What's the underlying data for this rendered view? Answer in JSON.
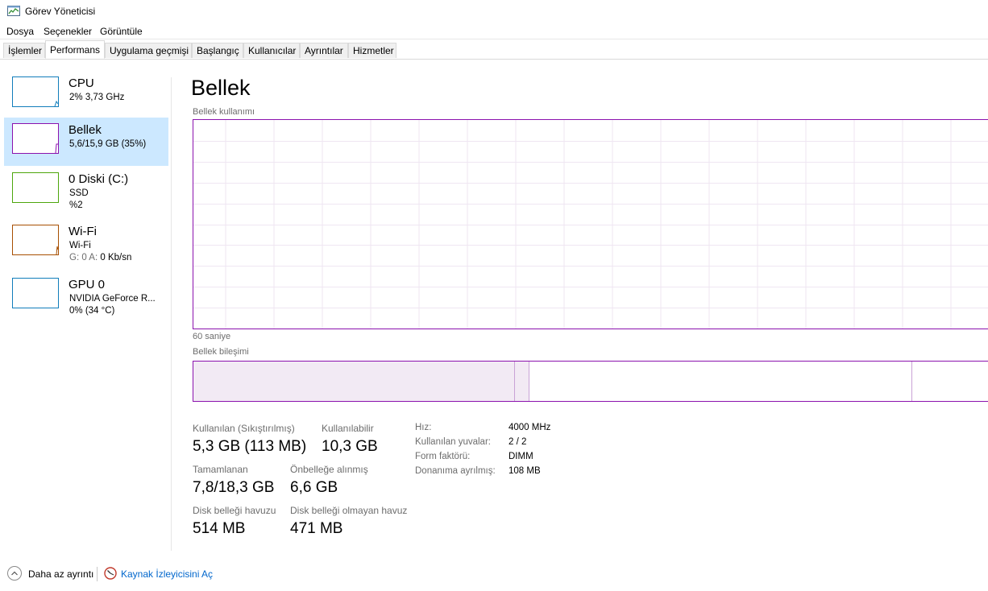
{
  "window": {
    "title": "Görev Yöneticisi"
  },
  "menu": [
    "Dosya",
    "Seçenekler",
    "Görüntüle"
  ],
  "tabs": [
    "İşlemler",
    "Performans",
    "Uygulama geçmişi",
    "Başlangıç",
    "Kullanıcılar",
    "Ayrıntılar",
    "Hizmetler"
  ],
  "active_tab": "Performans",
  "sidebar": {
    "items": [
      {
        "name": "CPU",
        "sub1": "2%  3,73 GHz",
        "sub2": "",
        "color": "#117dbb",
        "selected": false
      },
      {
        "name": "Bellek",
        "sub1": "5,6/15,9 GB (35%)",
        "sub2": "",
        "color": "#8b12ae",
        "selected": true
      },
      {
        "name": "0 Diski (C:)",
        "sub1": "SSD",
        "sub2": "%2",
        "color": "#4da60c",
        "selected": false
      },
      {
        "name": "Wi-Fi",
        "sub1": "Wi-Fi",
        "sub2_label": "G: 0 A:",
        "sub2_value": "0 Kb/sn",
        "color": "#a74f01",
        "selected": false
      },
      {
        "name": "GPU 0",
        "sub1": "NVIDIA GeForce R...",
        "sub2": "0% (34 °C)",
        "color": "#117dbb",
        "selected": false
      }
    ]
  },
  "main": {
    "title": "Bellek",
    "graph_label": "Bellek kullanımı",
    "time_label": "60 saniye",
    "composition_label": "Bellek bileşimi",
    "usage_percent": 35,
    "stats": {
      "used_label": "Kullanılan (Sıkıştırılmış)",
      "used_value": "5,3 GB (113 MB)",
      "available_label": "Kullanılabilir",
      "available_value": "10,3 GB",
      "committed_label": "Tamamlanan",
      "committed_value": "7,8/18,3 GB",
      "cached_label": "Önbelleğe alınmış",
      "cached_value": "6,6 GB",
      "paged_label": "Disk belleği havuzu",
      "paged_value": "514 MB",
      "nonpaged_label": "Disk belleği olmayan havuz",
      "nonpaged_value": "471 MB"
    },
    "specs": [
      {
        "label": "Hız:",
        "value": "4000 MHz"
      },
      {
        "label": "Kullanılan yuvalar:",
        "value": "2 / 2"
      },
      {
        "label": "Form faktörü:",
        "value": "DIMM"
      },
      {
        "label": "Donanıma ayrılmış:",
        "value": "108 MB"
      }
    ],
    "accent_color": "#8b12ae"
  },
  "footer": {
    "fewer_details": "Daha az ayrıntı",
    "resource_monitor": "Kaynak İzleyicisini Aç"
  }
}
